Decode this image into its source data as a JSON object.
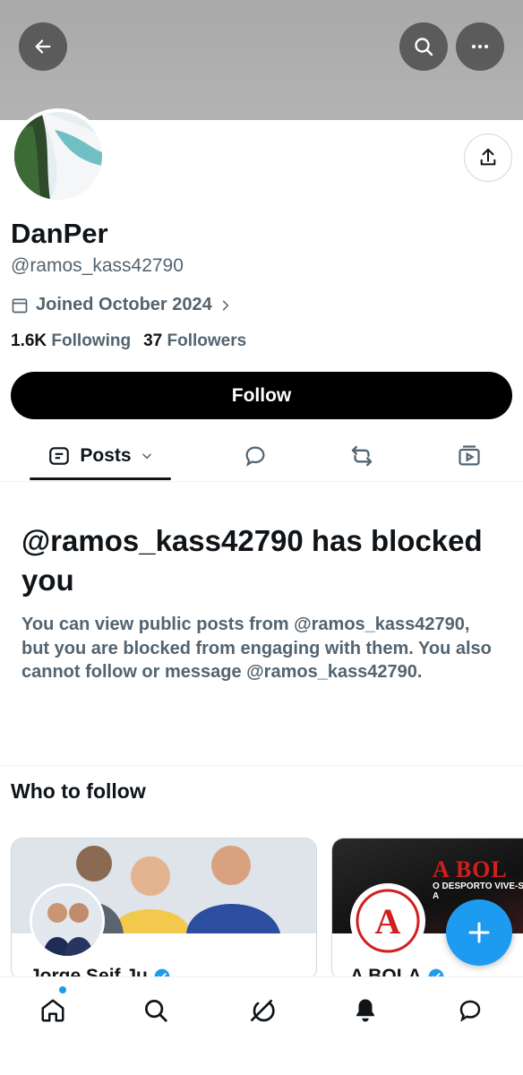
{
  "header": {
    "back_icon": "arrow-left-icon",
    "search_icon": "search-icon",
    "more_icon": "more-icon"
  },
  "profile": {
    "name": "DanPer",
    "handle": "@ramos_kass42790",
    "joined": "Joined October 2024",
    "following_count": "1.6K",
    "following_label": "Following",
    "followers_count": "37",
    "followers_label": "Followers",
    "follow_button": "Follow"
  },
  "tabs": {
    "posts_label": "Posts"
  },
  "blocked": {
    "title": "@ramos_kass42790 has blocked you",
    "message": "You can view public posts from @ramos_kass42790, but you are blocked from engaging with them. You also cannot follow or message @ramos_kass42790."
  },
  "who_to_follow": {
    "title": "Who to follow",
    "cards": [
      {
        "name": "Jorge Seif Ju"
      },
      {
        "name": "A BOLA",
        "banner_title": "A BOL",
        "banner_tagline": "O DESPORTO VIVE-SE A"
      }
    ]
  },
  "colors": {
    "accent": "#1d9bf0",
    "text_primary": "#0f1419",
    "text_secondary": "#536471",
    "abola_red": "#d01f1f"
  }
}
